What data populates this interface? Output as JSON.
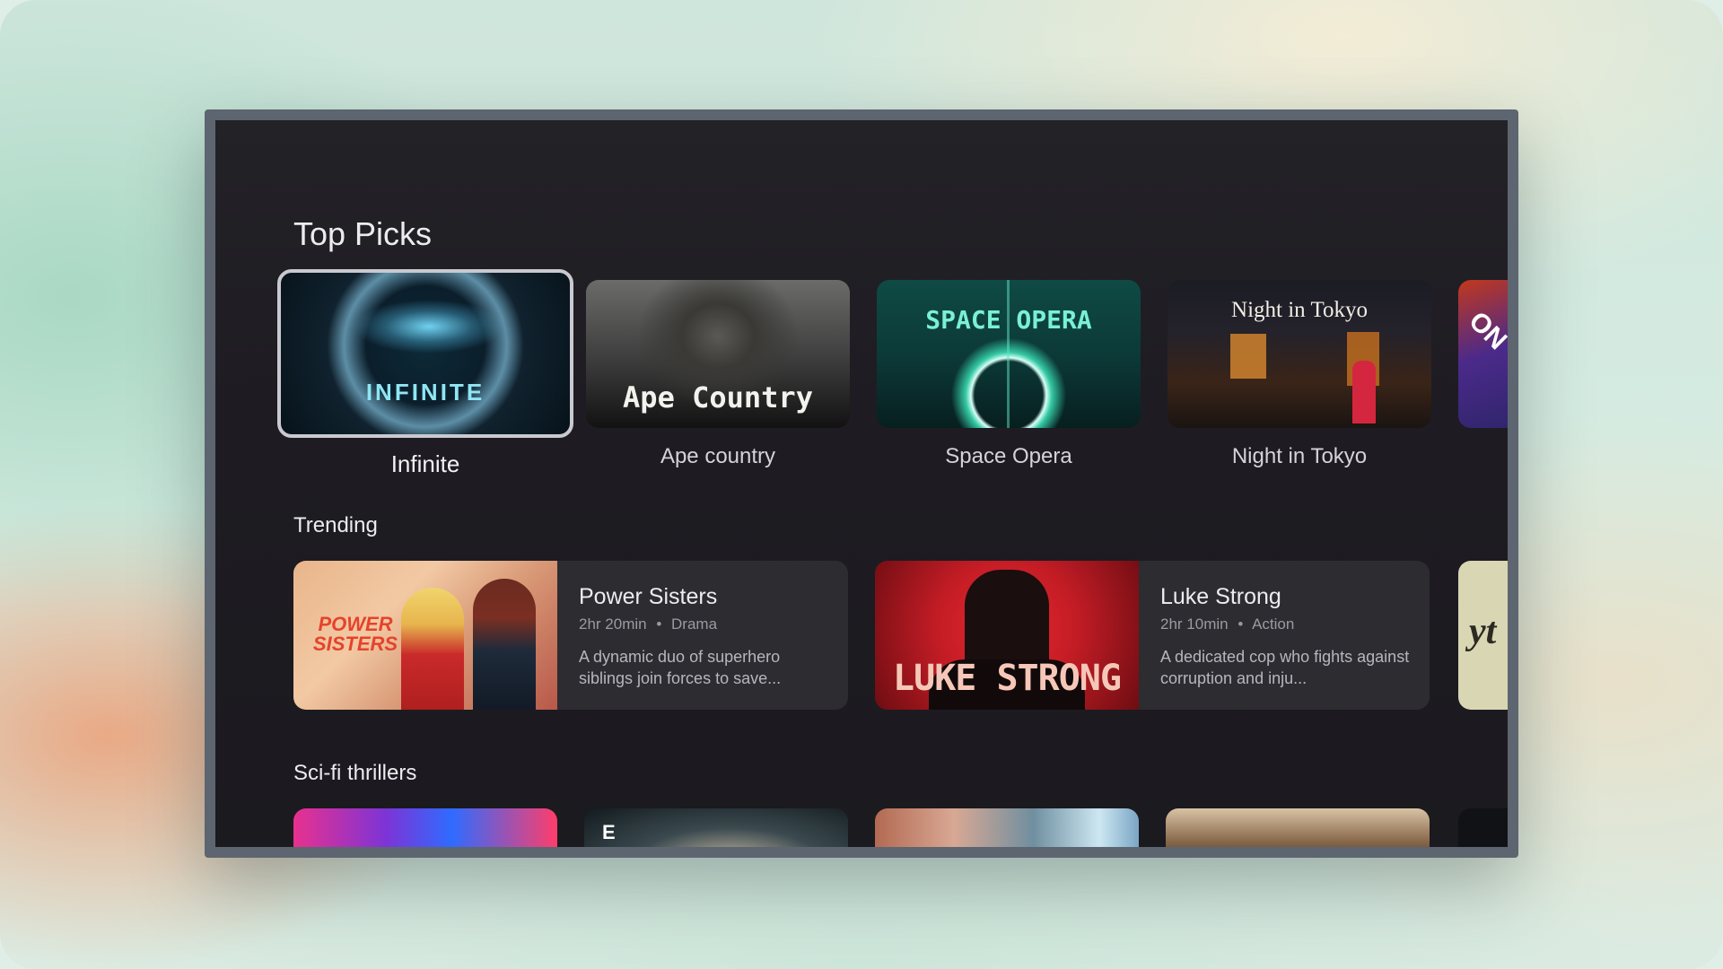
{
  "sections": {
    "top_picks": "Top Picks",
    "trending": "Trending",
    "scifi": "Sci-fi thrillers"
  },
  "top_picks": [
    {
      "title": "Infinite",
      "poster_text": "INFINITE"
    },
    {
      "title": "Ape country",
      "poster_text": "Ape Country"
    },
    {
      "title": "Space Opera",
      "poster_text": "SPACE OPERA"
    },
    {
      "title": "Night in Tokyo",
      "poster_text": "Night in Tokyo"
    },
    {
      "poster_text": "ON"
    }
  ],
  "trending": [
    {
      "title": "Power Sisters",
      "duration": "2hr 20min",
      "genre": "Drama",
      "description": "A dynamic duo of superhero siblings join forces to save...",
      "poster_text": "POWER SISTERS"
    },
    {
      "title": "Luke Strong",
      "duration": "2hr 10min",
      "genre": "Action",
      "description": "A dedicated cop who fights against corruption and inju...",
      "poster_text": "LUKE STRONG"
    },
    {
      "poster_text": "yt"
    }
  ],
  "scifi": [
    {
      "poster_text": ""
    },
    {
      "poster_text": "E"
    },
    {
      "poster_text": ""
    },
    {
      "poster_text": ""
    },
    {
      "poster_text": ""
    }
  ],
  "meta_separator": "•"
}
